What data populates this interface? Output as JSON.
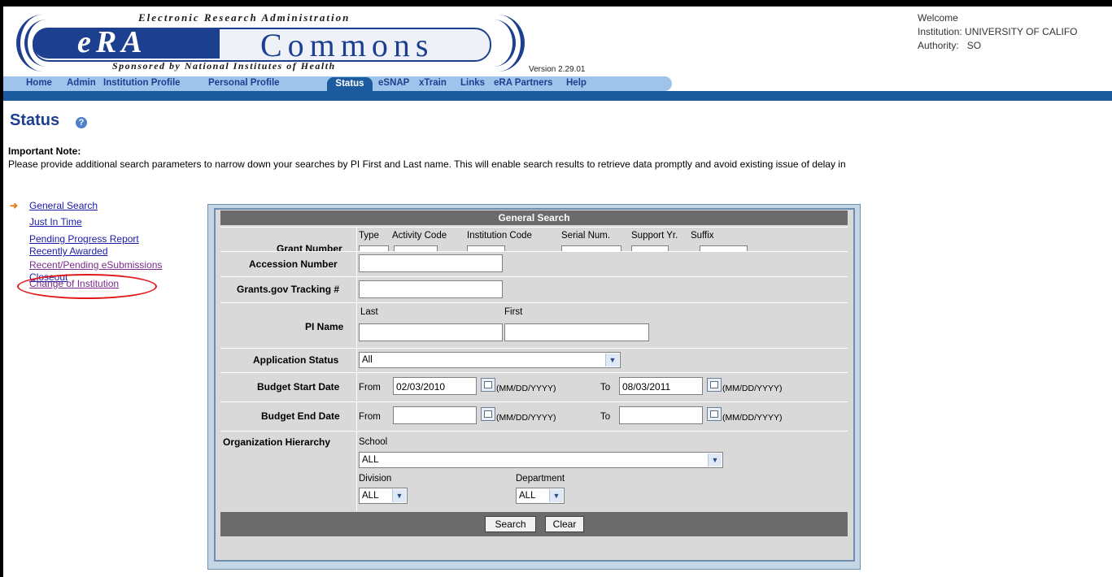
{
  "header": {
    "logo_top_text": "Electronic Research Administration",
    "logo_era": "eRA",
    "logo_commons": "Commons",
    "logo_bottom_text": "Sponsored by National Institutes of Health",
    "version": "Version 2.29.01",
    "welcome": "Welcome",
    "institution": "Institution: UNIVERSITY OF CALIFO",
    "authority": "Authority:   SO"
  },
  "nav": {
    "items": [
      "Home",
      "Admin",
      "Institution Profile",
      "Personal Profile",
      "Status",
      "eSNAP",
      "xTrain",
      "Links",
      "eRA Partners",
      "Help"
    ],
    "active": "Status"
  },
  "page": {
    "title": "Status",
    "help_icon_glyph": "?",
    "note_title": "Important Note:",
    "note_text": "Please provide additional search parameters to narrow down your searches by PI First and Last name. This will enable search results to retrieve data promptly and avoid existing issue of delay in"
  },
  "left_menu": {
    "items": [
      "General Search",
      "Just In Time",
      "Pending Progress Report",
      "Recently Awarded",
      "Recent/Pending eSubmissions",
      "Closeout",
      "Change of Institution"
    ],
    "current": "General Search"
  },
  "form": {
    "title": "General Search",
    "grant_number": {
      "label": "Grant Number",
      "subfields": [
        "Type",
        "Activity Code",
        "Institution Code",
        "Serial Num.",
        "Support Yr.",
        "Suffix"
      ]
    },
    "accession_label": "Accession Number",
    "grants_gov_label": "Grants.gov Tracking #",
    "pi_name": {
      "label": "PI Name",
      "last": "Last",
      "first": "First"
    },
    "application_status": {
      "label": "Application Status",
      "value": "All"
    },
    "budget_start": {
      "label": "Budget Start Date",
      "from": "From",
      "from_value": "02/03/2010",
      "to": "To",
      "to_value": "08/03/2011",
      "format": "(MM/DD/YYYY)"
    },
    "budget_end": {
      "label": "Budget End Date",
      "from": "From",
      "from_value": "",
      "to": "To",
      "to_value": "",
      "format": "(MM/DD/YYYY)"
    },
    "org_hierarchy": {
      "label": "Organization Hierarchy",
      "school": "School",
      "school_value": "ALL",
      "division": "Division",
      "division_value": "ALL",
      "department": "Department",
      "department_value": "ALL"
    },
    "search_button": "Search",
    "clear_button": "Clear"
  }
}
